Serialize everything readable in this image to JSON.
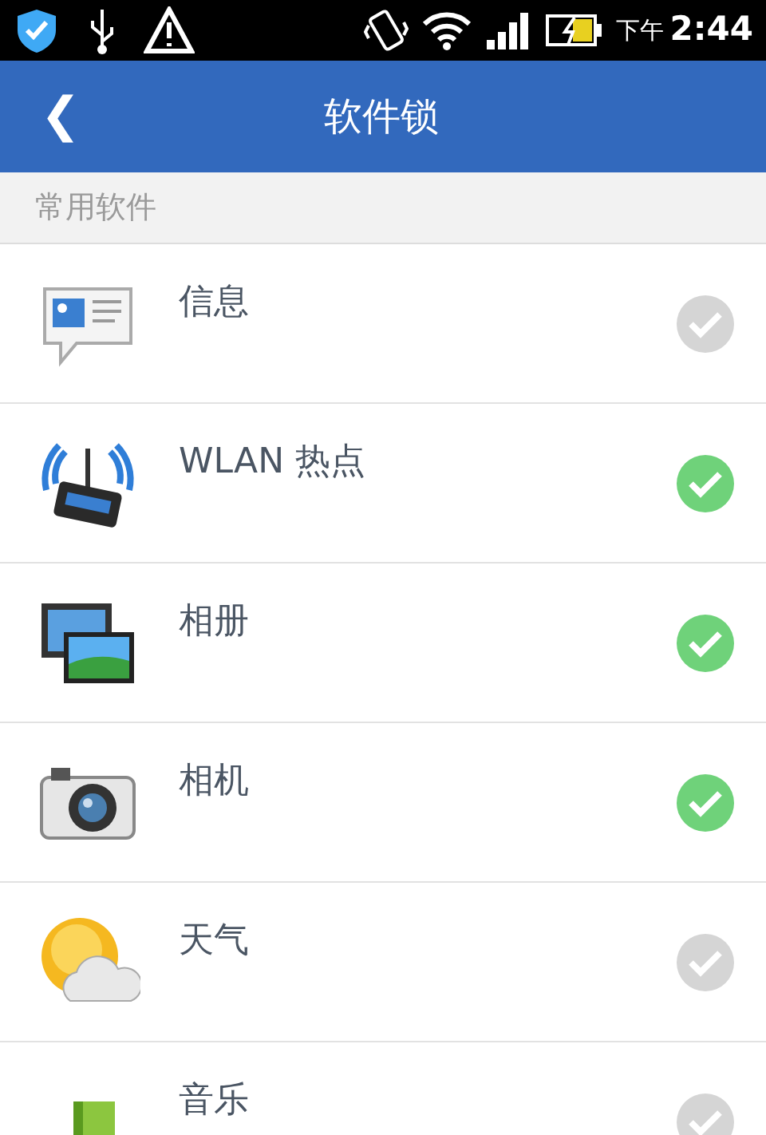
{
  "status_bar": {
    "period": "下午",
    "time": "2:44"
  },
  "header": {
    "back": "❮",
    "title": "软件锁"
  },
  "section": {
    "title": "常用软件"
  },
  "apps": [
    {
      "name": "信息",
      "checked": false
    },
    {
      "name": "WLAN 热点",
      "checked": true
    },
    {
      "name": "相册",
      "checked": true
    },
    {
      "name": "相机",
      "checked": true
    },
    {
      "name": "天气",
      "checked": false
    },
    {
      "name": "音乐",
      "checked": false
    }
  ]
}
